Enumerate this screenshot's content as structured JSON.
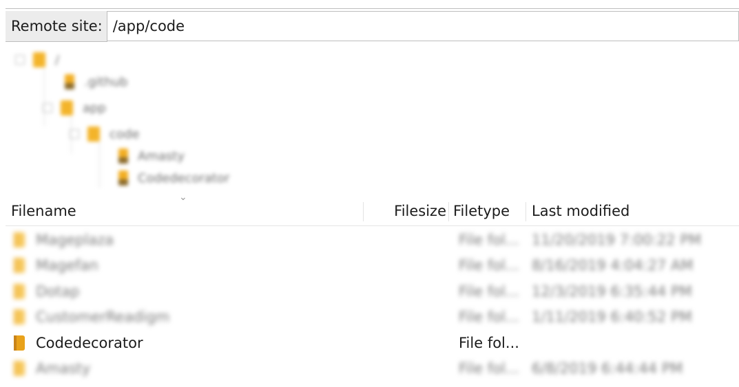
{
  "remote_site": {
    "label": "Remote site:",
    "path": "/app/code"
  },
  "tree": {
    "nodes": [
      {
        "label": "/"
      },
      {
        "label": ".github"
      },
      {
        "label": "app"
      },
      {
        "label": "code"
      },
      {
        "label": "Amasty"
      },
      {
        "label": "Codedecorator"
      }
    ]
  },
  "file_list": {
    "columns": {
      "filename": "Filename",
      "filesize": "Filesize",
      "filetype": "Filetype",
      "last_modified": "Last modified"
    },
    "rows": [
      {
        "filename": "Mageplaza",
        "filesize": "",
        "filetype": "File fol...",
        "last_modified": "11/20/2019 7:00:22 PM"
      },
      {
        "filename": "Magefan",
        "filesize": "",
        "filetype": "File fol...",
        "last_modified": "8/16/2019 4:04:27 AM"
      },
      {
        "filename": "Dotap",
        "filesize": "",
        "filetype": "File fol...",
        "last_modified": "12/3/2019 6:35:44 PM"
      },
      {
        "filename": "CustomerReadigm",
        "filesize": "",
        "filetype": "File fol...",
        "last_modified": "1/11/2019 6:40:52 PM"
      },
      {
        "filename": "Codedecorator",
        "filesize": "",
        "filetype": "File fol...",
        "last_modified": ""
      },
      {
        "filename": "Amasty",
        "filesize": "",
        "filetype": "File fol...",
        "last_modified": "6/8/2019 6:44:44 PM"
      }
    ]
  }
}
